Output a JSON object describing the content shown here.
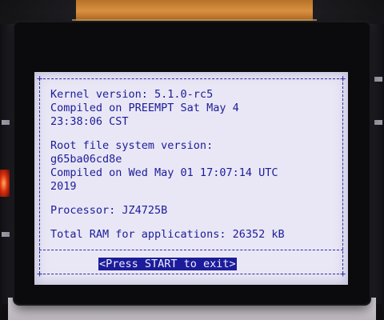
{
  "screen": {
    "kernel_version": "Kernel version: 5.1.0-rc5",
    "kernel_compiled_1": "Compiled on PREEMPT Sat May 4",
    "kernel_compiled_2": "23:38:06 CST",
    "rootfs_version_label": "Root file system version:",
    "rootfs_version_value": "g65ba06cd8e",
    "rootfs_compiled_1": "Compiled on Wed May 01 17:07:14 UTC",
    "rootfs_compiled_2": "2019",
    "processor": "Processor: JZ4725B",
    "total_ram": "Total RAM for applications: 26352 kB",
    "exit_button_label": "<Press START to exit>"
  },
  "colors": {
    "screen_bg": "#e9e7f5",
    "text": "#1c1c9a",
    "highlight_bg": "#1c1c9a",
    "highlight_text": "#eeeefa"
  }
}
